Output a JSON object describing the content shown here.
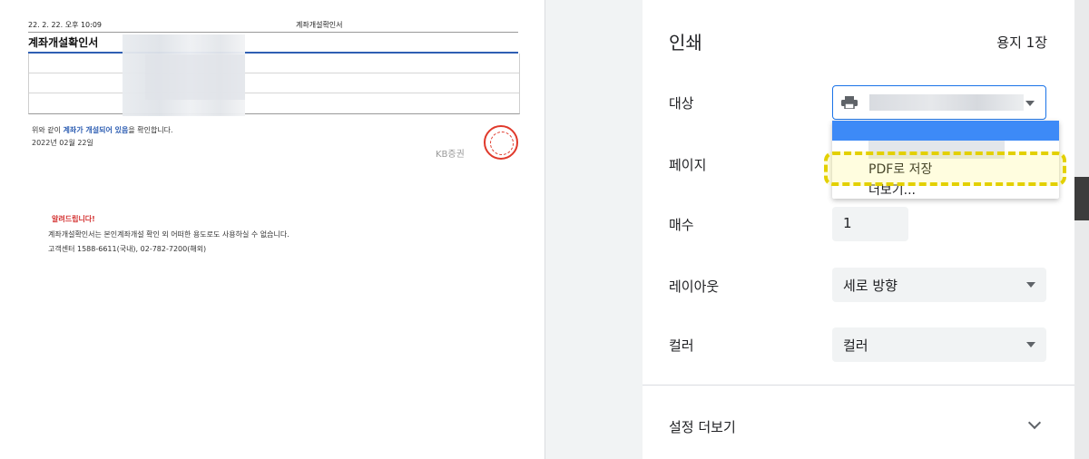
{
  "document": {
    "header_datetime": "22. 2. 22. 오후 10:09",
    "header_title": "계좌개설확인서",
    "title": "계좌개설확인서",
    "confirm_prefix": "위와 같이 ",
    "confirm_highlight": "계좌가 개설되어 있음",
    "confirm_suffix": "을 확인합니다.",
    "date": "2022년 02월 22일",
    "logo_text": "KB증권",
    "notice_title": "알려드립니다!",
    "notice_line1": "계좌개설확인서는 본인계좌개설 확인 외 어떠한 용도로도 사용하실 수 없습니다.",
    "notice_line2": "고객센터 1588-6611(국내), 02-782-7200(해외)"
  },
  "print_panel": {
    "title": "인쇄",
    "sheet_count": "용지 1장",
    "destination_label": "대상",
    "pages_label": "페이지",
    "copies_label": "매수",
    "copies_value": "1",
    "layout_label": "레이아웃",
    "layout_value": "세로 방향",
    "color_label": "컬러",
    "color_value": "컬러",
    "more_settings": "설정 더보기",
    "dropdown": {
      "save_pdf": "PDF로 저장",
      "see_more": "더보기..."
    }
  },
  "colors": {
    "accent": "#1a73e8",
    "selected_option": "#3d8af7",
    "highlight": "#e3d000",
    "seal": "#e0392b",
    "doc_blue": "#2f5fb3"
  }
}
